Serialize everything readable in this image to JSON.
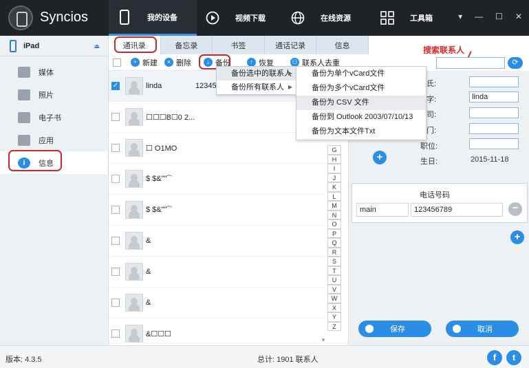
{
  "app": {
    "title": "Syncios"
  },
  "nav": [
    {
      "label": "我的设备",
      "icon": "phone-icon",
      "active": true
    },
    {
      "label": "视频下载",
      "icon": "play-icon"
    },
    {
      "label": "在线资源",
      "icon": "globe-icon"
    },
    {
      "label": "工具箱",
      "icon": "grid-icon"
    }
  ],
  "sidebar": {
    "device": "iPad",
    "items": [
      {
        "label": "媒体",
        "icon": "media-icon"
      },
      {
        "label": "照片",
        "icon": "photo-icon"
      },
      {
        "label": "电子书",
        "icon": "ebook-icon"
      },
      {
        "label": "应用",
        "icon": "apps-icon"
      },
      {
        "label": "信息",
        "icon": "info-icon",
        "active": true
      }
    ]
  },
  "tabs": [
    {
      "label": "通讯录",
      "active": true
    },
    {
      "label": "备忘录"
    },
    {
      "label": "书签"
    },
    {
      "label": "通话记录"
    },
    {
      "label": "信息"
    }
  ],
  "toolbar": {
    "new": "新建",
    "delete": "删除",
    "backup": "备份",
    "restore": "恢复",
    "dedupe": "联系人去重"
  },
  "search": {
    "annotation": "搜索联系人"
  },
  "backup_menu": {
    "items": [
      "备份选中的联系人",
      "备份所有联系人"
    ]
  },
  "backup_submenu": {
    "items": [
      "备份为单个vCard文件",
      "备份为多个vCard文件",
      "备份为 CSV 文件",
      "备份到 Outlook 2003/07/10/13",
      "备份为文本文件Txt"
    ]
  },
  "contacts": [
    {
      "name": "linda",
      "phone": "12345",
      "checked": true
    },
    {
      "name": "☐☐☐B☐0 2...",
      "phone": ""
    },
    {
      "name": "☐ O1MO",
      "phone": ""
    },
    {
      "name": "$  $&\"\"͡",
      "phone": ""
    },
    {
      "name": "$  $&\"\"͡",
      "phone": ""
    },
    {
      "name": "&",
      "phone": ""
    },
    {
      "name": "&",
      "phone": ""
    },
    {
      "name": "&",
      "phone": ""
    },
    {
      "name": "&☐☐☐",
      "phone": ""
    }
  ],
  "alphabet": [
    "G",
    "H",
    "I",
    "J",
    "K",
    "L",
    "M",
    "N",
    "O",
    "P",
    "Q",
    "R",
    "S",
    "T",
    "U",
    "V",
    "W",
    "X",
    "Y",
    "Z"
  ],
  "detail": {
    "labels": {
      "surname": "氏:",
      "given": "字:",
      "company": "司:",
      "department": "门:",
      "title": "职位:",
      "birthday": "生日:"
    },
    "given_value": "linda",
    "birthday_value": "2015-11-18",
    "phone_section_title": "电话号码",
    "phone_type": "main",
    "phone_number": "123456789",
    "save": "保存",
    "cancel": "取消"
  },
  "status": {
    "version": "版本: 4.3.5",
    "total": "总计: 1901 联系人"
  },
  "colors": {
    "accent": "#2a8ee6",
    "highlight_red": "#c9282d",
    "topbar": "#1f2227"
  }
}
